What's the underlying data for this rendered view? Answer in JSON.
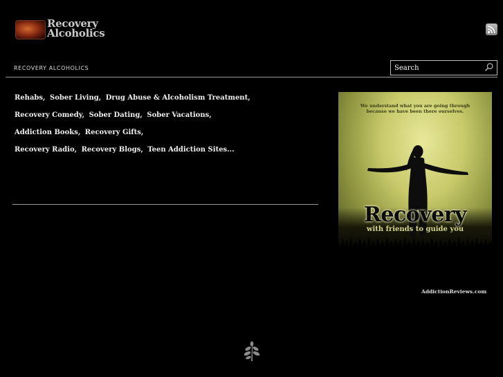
{
  "logo": {
    "line1": "Recovery",
    "line2": "Alcoholics"
  },
  "nav": {
    "site_title": "RECOVERY ALCOHOLICS"
  },
  "search": {
    "placeholder": "Search",
    "value": ""
  },
  "links": {
    "rows": [
      [
        "Rehabs,",
        "Sober Living,",
        "Drug Abuse & Alcoholism Treatment,"
      ],
      [
        "Recovery Comedy,",
        "Sober Dating,",
        "Sober Vacations,"
      ],
      [
        "Addiction Books,",
        "Recovery Gifts,"
      ],
      [
        "Recovery Radio,",
        "Recovery Blogs,",
        "Teen Addiction Sites..."
      ]
    ]
  },
  "banner": {
    "tagline_1": "We understand what you are going through",
    "tagline_2": "because we have been there ourselves.",
    "headline": "Recovery",
    "subline": "with friends to guide you"
  },
  "credit": "AddictionReviews.com",
  "colors": {
    "background": "#000000",
    "text": "#f0f0f0",
    "rule": "#9a9a9a",
    "banner_accent": "#d7d789"
  },
  "icons": [
    "rss-icon",
    "search-icon",
    "leaf-icon"
  ]
}
